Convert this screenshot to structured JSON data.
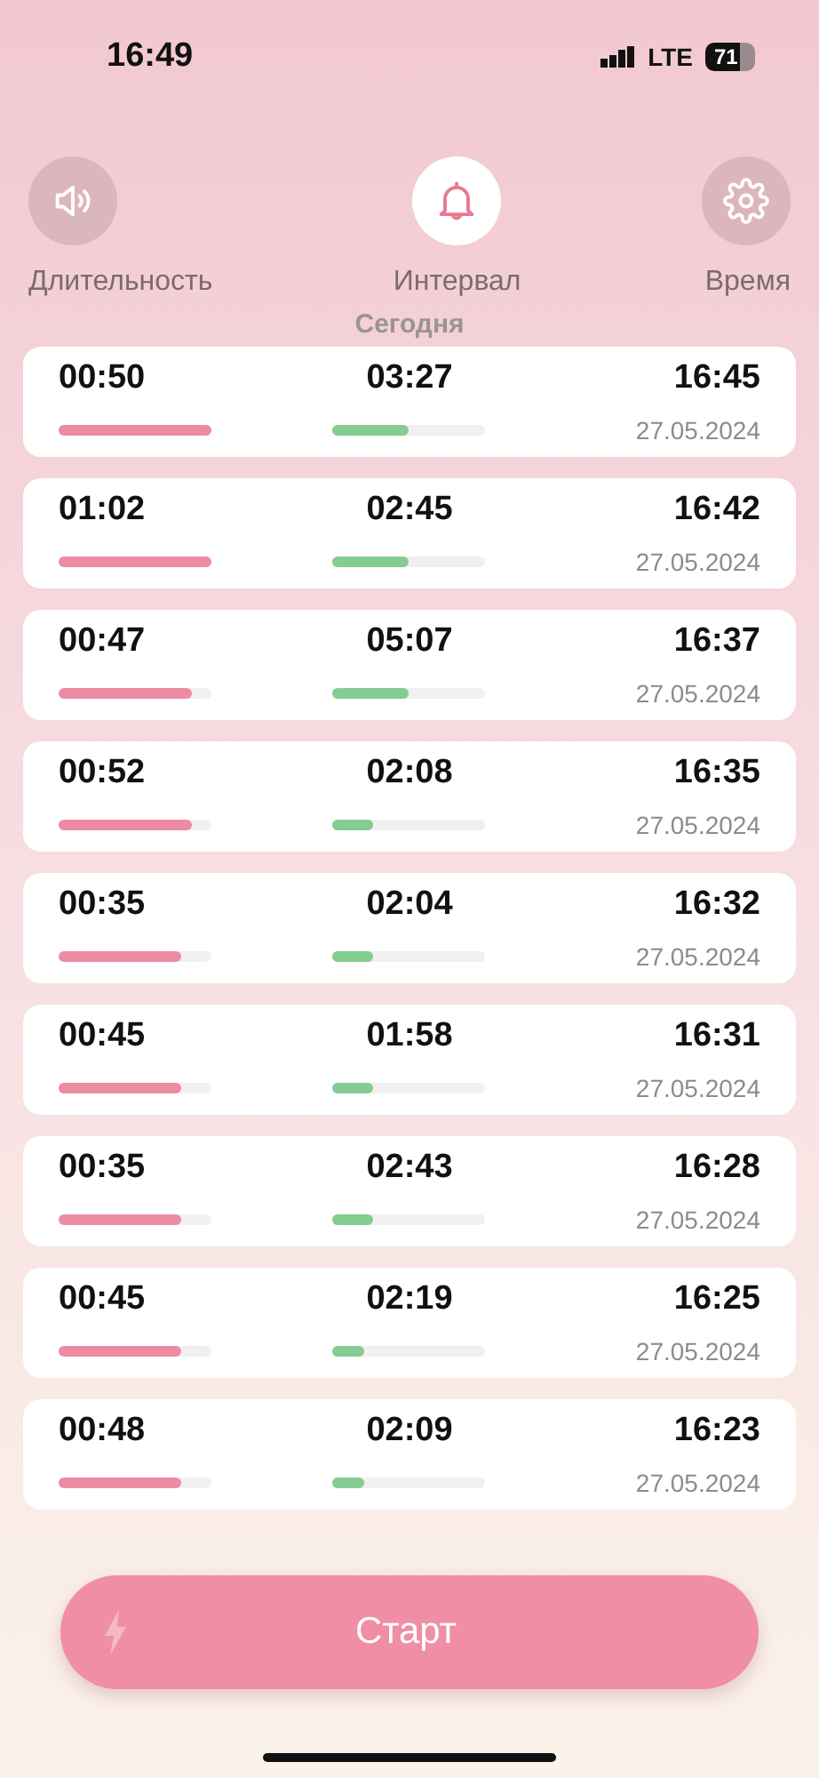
{
  "status_bar": {
    "time": "16:49",
    "network": "LTE",
    "battery": "71"
  },
  "tabs": [
    {
      "kind": "sound",
      "label": "Длительность",
      "selected": false
    },
    {
      "kind": "bell",
      "label": "Интервал",
      "selected": true
    },
    {
      "kind": "gear",
      "label": "Время",
      "selected": false
    }
  ],
  "section_title": "Сегодня",
  "entries": [
    {
      "duration": "00:50",
      "duration_bar": {
        "level": 1
      },
      "interval": "03:27",
      "interval_bar": {
        "level": 0.5
      },
      "time": "16:45",
      "date": "27.05.2024"
    },
    {
      "duration": "01:02",
      "duration_bar": {
        "level": 1
      },
      "interval": "02:45",
      "interval_bar": {
        "level": 0.5
      },
      "time": "16:42",
      "date": "27.05.2024"
    },
    {
      "duration": "00:47",
      "duration_bar": {
        "level": 0.87
      },
      "interval": "05:07",
      "interval_bar": {
        "level": 0.5
      },
      "time": "16:37",
      "date": "27.05.2024"
    },
    {
      "duration": "00:52",
      "duration_bar": {
        "level": 0.87
      },
      "interval": "02:08",
      "interval_bar": {
        "level": 0.26
      },
      "time": "16:35",
      "date": "27.05.2024"
    },
    {
      "duration": "00:35",
      "duration_bar": {
        "level": 0.8
      },
      "interval": "02:04",
      "interval_bar": {
        "level": 0.26
      },
      "time": "16:32",
      "date": "27.05.2024"
    },
    {
      "duration": "00:45",
      "duration_bar": {
        "level": 0.8
      },
      "interval": "01:58",
      "interval_bar": {
        "level": 0.26
      },
      "time": "16:31",
      "date": "27.05.2024"
    },
    {
      "duration": "00:35",
      "duration_bar": {
        "level": 0.8
      },
      "interval": "02:43",
      "interval_bar": {
        "level": 0.26
      },
      "time": "16:28",
      "date": "27.05.2024"
    },
    {
      "duration": "00:45",
      "duration_bar": {
        "level": 0.8
      },
      "interval": "02:19",
      "interval_bar": {
        "level": 0.2
      },
      "time": "16:25",
      "date": "27.05.2024"
    },
    {
      "duration": "00:48",
      "duration_bar": {
        "level": 0.8
      },
      "interval": "02:09",
      "interval_bar": {
        "level": 0.2
      },
      "time": "16:23",
      "date": "27.05.2024"
    }
  ],
  "start_button": {
    "label": "Старт"
  }
}
